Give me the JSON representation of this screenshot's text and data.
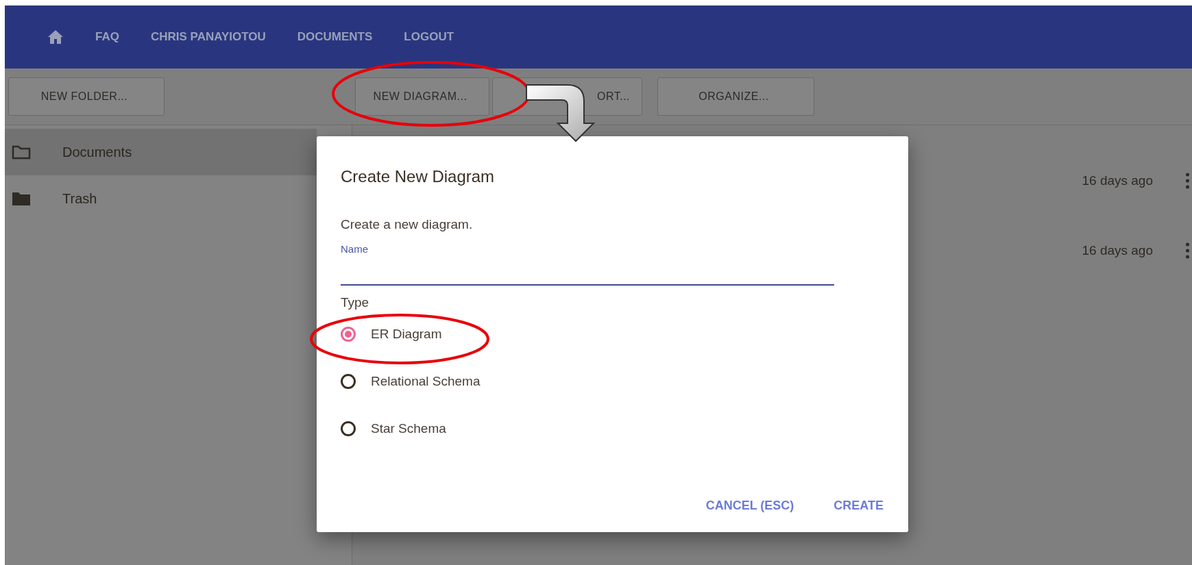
{
  "nav": {
    "links": [
      {
        "label": "FAQ"
      },
      {
        "label": "CHRIS PANAYIOTOU"
      },
      {
        "label": "DOCUMENTS"
      },
      {
        "label": "LOGOUT"
      }
    ]
  },
  "toolbar": {
    "left_buttons": [
      "NEW FOLDER..."
    ],
    "buttons": [
      "NEW DIAGRAM...",
      "ORT...",
      "ORGANIZE..."
    ]
  },
  "sidebar": {
    "items": [
      {
        "label": "Documents",
        "kind": "outline",
        "selected": true
      },
      {
        "label": "Trash",
        "kind": "filled",
        "selected": false
      }
    ]
  },
  "list": {
    "rows": [
      {
        "time": "16 days ago"
      },
      {
        "time": "16 days ago"
      }
    ]
  },
  "dialog": {
    "title": "Create New Diagram",
    "description": "Create a new diagram.",
    "name_field": {
      "label": "Name",
      "focused": true
    },
    "type_label": "Type",
    "options": [
      {
        "label": "ER Diagram",
        "selected": true
      },
      {
        "label": "Relational Schema",
        "selected": false
      },
      {
        "label": "Star Schema",
        "selected": false
      }
    ],
    "actions": [
      "CANCEL (ESC)",
      "CREATE"
    ]
  }
}
